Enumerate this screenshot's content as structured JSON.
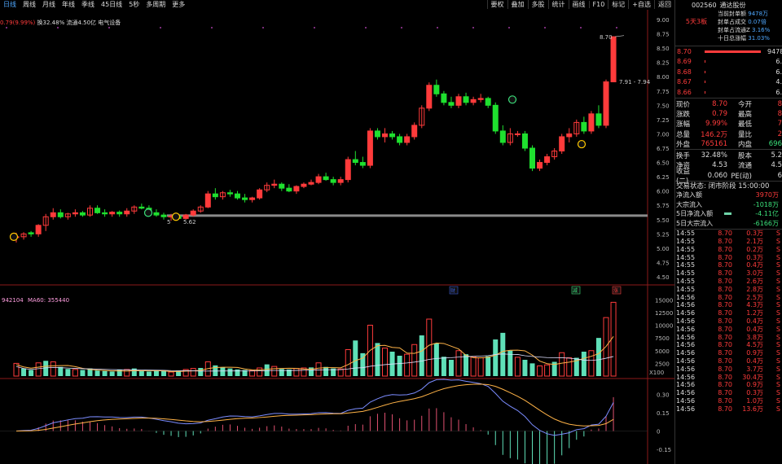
{
  "toolbar": {
    "tabs": [
      "日线",
      "周线",
      "月线",
      "年线",
      "季线",
      "45日线",
      "5秒",
      "多周期",
      "更多"
    ],
    "tools": [
      "要权",
      "叠加",
      "多股",
      "统计",
      "画线",
      "F10",
      "标记",
      "+自选",
      "返回"
    ]
  },
  "info": {
    "price_change": "0.79(9.99%)",
    "turnover": "换32.48%",
    "float": "流通4.50亿",
    "industry": "电气设备"
  },
  "price_axis": [
    "9.00",
    "8.75",
    "8.50",
    "8.25",
    "8.00",
    "7.75",
    "7.50",
    "7.25",
    "7.00",
    "6.75",
    "6.50",
    "6.25",
    "6.00",
    "5.75",
    "5.50",
    "5.25",
    "5.00",
    "4.75",
    "4.50"
  ],
  "chart_annotations": {
    "high_label": "8.70",
    "range_label": "7.91 - 7.94",
    "low_label": "5.62",
    "left_label": "5"
  },
  "badges": {
    "fin": "财",
    "jian": "减",
    "zhang": "涨"
  },
  "volume": {
    "header": "942104",
    "ma60_label": "MA60: 355440",
    "axis": [
      "15000",
      "12500",
      "10000",
      "7500",
      "5000",
      "2500"
    ],
    "unit": "X100"
  },
  "macd_axis": [
    "0.30",
    "0.15",
    "0",
    "-0.15"
  ],
  "stock": {
    "code": "002560",
    "name": "通达股份",
    "tag": "5天3板",
    "limit_info": [
      {
        "label": "当前封单额",
        "value": "9478万"
      },
      {
        "label": "封单占成交",
        "value": "0.07倍"
      },
      {
        "label": "封单占流通Z",
        "value": "3.16%"
      },
      {
        "label": "十日总涨幅",
        "value": "31.03%"
      }
    ]
  },
  "orderbook": [
    {
      "price": "8.70",
      "volume": "9478",
      "bar": 0.9
    },
    {
      "price": "8.69",
      "volume": "6.",
      "bar": 0.01
    },
    {
      "price": "8.68",
      "volume": "6.",
      "bar": 0.01
    },
    {
      "price": "8.67",
      "volume": "4.",
      "bar": 0.01
    },
    {
      "price": "8.66",
      "volume": "6.",
      "bar": 0.01
    }
  ],
  "quote": [
    {
      "l": "现价",
      "v": "8.70",
      "l2": "今开",
      "v2": "8"
    },
    {
      "l": "涨跌",
      "v": "0.79",
      "l2": "最高",
      "v2": "8"
    },
    {
      "l": "涨幅",
      "v": "9.99%",
      "l2": "最低",
      "v2": "7"
    },
    {
      "l": "总量",
      "v": "146.2万",
      "l2": "量比",
      "v2": "2"
    },
    {
      "l": "外盘",
      "v": "765161",
      "l2": "内盘",
      "v2": "696"
    }
  ],
  "quote2": [
    {
      "l": "换手",
      "v": "32.48%",
      "l2": "股本",
      "v2": "5.2"
    },
    {
      "l": "净资",
      "v": "4.53",
      "l2": "流通",
      "v2": "4.5"
    },
    {
      "l": "收益(二)",
      "v": "0.060",
      "l2": "PE(动)",
      "v2": "6"
    }
  ],
  "status": "交易状态: 闭市阶段 15:00:00",
  "money_flow": [
    {
      "l": "净流入额",
      "v": "3970万",
      "bar": 0,
      "g": false
    },
    {
      "l": "大宗流入",
      "v": "-1018万",
      "bar": 0,
      "g": true
    },
    {
      "l": "5日净流入额",
      "v": "-4.11亿",
      "bar": 0.3,
      "g": true
    },
    {
      "l": "5日大宗流入",
      "v": "-6166万",
      "bar": 0,
      "g": true
    }
  ],
  "ticks": [
    {
      "t": "14:55",
      "p": "8.70",
      "v": "0.3万",
      "s": "S"
    },
    {
      "t": "14:55",
      "p": "8.70",
      "v": "2.1万",
      "s": "S"
    },
    {
      "t": "14:55",
      "p": "8.70",
      "v": "0.2万",
      "s": "S"
    },
    {
      "t": "14:55",
      "p": "8.70",
      "v": "0.3万",
      "s": "S"
    },
    {
      "t": "14:55",
      "p": "8.70",
      "v": "0.4万",
      "s": "S"
    },
    {
      "t": "14:55",
      "p": "8.70",
      "v": "3.0万",
      "s": "S"
    },
    {
      "t": "14:55",
      "p": "8.70",
      "v": "2.6万",
      "s": "S"
    },
    {
      "t": "14:55",
      "p": "8.70",
      "v": "2.8万",
      "s": "S"
    },
    {
      "t": "14:56",
      "p": "8.70",
      "v": "2.5万",
      "s": "S"
    },
    {
      "t": "14:56",
      "p": "8.70",
      "v": "4.3万",
      "s": "S"
    },
    {
      "t": "14:56",
      "p": "8.70",
      "v": "1.2万",
      "s": "S"
    },
    {
      "t": "14:56",
      "p": "8.70",
      "v": "0.4万",
      "s": "S"
    },
    {
      "t": "14:56",
      "p": "8.70",
      "v": "0.4万",
      "s": "S"
    },
    {
      "t": "14:56",
      "p": "8.70",
      "v": "3.8万",
      "s": "S"
    },
    {
      "t": "14:56",
      "p": "8.70",
      "v": "4.5万",
      "s": "S"
    },
    {
      "t": "14:56",
      "p": "8.70",
      "v": "0.9万",
      "s": "S"
    },
    {
      "t": "14:56",
      "p": "8.70",
      "v": "0.4万",
      "s": "S"
    },
    {
      "t": "14:56",
      "p": "8.70",
      "v": "3.7万",
      "s": "S"
    },
    {
      "t": "14:56",
      "p": "8.70",
      "v": "30.4万",
      "s": "S"
    },
    {
      "t": "14:56",
      "p": "8.70",
      "v": "0.9万",
      "s": "S"
    },
    {
      "t": "14:56",
      "p": "8.70",
      "v": "0.3万",
      "s": "S"
    },
    {
      "t": "14:56",
      "p": "8.70",
      "v": "1.0万",
      "s": "S"
    },
    {
      "t": "14:56",
      "p": "8.70",
      "v": "13.6万",
      "s": "S"
    }
  ],
  "colors": {
    "up": "#ff3b3b",
    "down": "#1fe02f",
    "ma": "#ffb347",
    "bg": "#000000"
  },
  "chart_data": {
    "type": "candlestick",
    "candles": [
      [
        5.2,
        5.27,
        5.1,
        5.2
      ],
      [
        5.2,
        5.28,
        5.15,
        5.25
      ],
      [
        5.27,
        5.3,
        5.2,
        5.25
      ],
      [
        5.25,
        5.42,
        5.2,
        5.4
      ],
      [
        5.4,
        5.6,
        5.3,
        5.55
      ],
      [
        5.55,
        5.7,
        5.5,
        5.62
      ],
      [
        5.62,
        5.68,
        5.52,
        5.55
      ],
      [
        5.55,
        5.62,
        5.5,
        5.6
      ],
      [
        5.6,
        5.68,
        5.55,
        5.62
      ],
      [
        5.62,
        5.65,
        5.55,
        5.58
      ],
      [
        5.58,
        5.75,
        5.55,
        5.7
      ],
      [
        5.7,
        5.75,
        5.6,
        5.62
      ],
      [
        5.62,
        5.68,
        5.55,
        5.6
      ],
      [
        5.6,
        5.65,
        5.55,
        5.63
      ],
      [
        5.63,
        5.66,
        5.55,
        5.6
      ],
      [
        5.6,
        5.7,
        5.55,
        5.65
      ],
      [
        5.65,
        5.75,
        5.6,
        5.72
      ],
      [
        5.72,
        5.78,
        5.68,
        5.7
      ],
      [
        5.7,
        5.75,
        5.6,
        5.62
      ],
      [
        5.62,
        5.68,
        5.55,
        5.58
      ],
      [
        5.58,
        5.62,
        5.5,
        5.55
      ],
      [
        5.55,
        5.6,
        5.48,
        5.56
      ],
      [
        5.56,
        5.6,
        5.5,
        5.52
      ],
      [
        5.52,
        5.6,
        5.5,
        5.58
      ],
      [
        5.58,
        5.68,
        5.55,
        5.65
      ],
      [
        5.65,
        5.75,
        5.62,
        5.72
      ],
      [
        5.72,
        6.0,
        5.7,
        5.95
      ],
      [
        5.95,
        6.05,
        5.85,
        5.9
      ],
      [
        5.9,
        6.0,
        5.85,
        5.97
      ],
      [
        5.97,
        6.02,
        5.9,
        5.95
      ],
      [
        5.95,
        6.0,
        5.85,
        5.88
      ],
      [
        5.88,
        5.95,
        5.8,
        5.85
      ],
      [
        5.85,
        5.9,
        5.8,
        5.88
      ],
      [
        5.88,
        6.05,
        5.85,
        6.02
      ],
      [
        6.02,
        6.15,
        5.98,
        6.1
      ],
      [
        6.1,
        6.2,
        6.05,
        6.12
      ],
      [
        6.12,
        6.15,
        6.0,
        6.05
      ],
      [
        6.05,
        6.12,
        5.98,
        6.0
      ],
      [
        6.0,
        6.1,
        5.95,
        6.08
      ],
      [
        6.08,
        6.15,
        6.05,
        6.12
      ],
      [
        6.12,
        6.2,
        6.1,
        6.15
      ],
      [
        6.15,
        6.3,
        6.12,
        6.25
      ],
      [
        6.25,
        6.32,
        6.18,
        6.2
      ],
      [
        6.2,
        6.25,
        6.1,
        6.15
      ],
      [
        6.15,
        6.25,
        6.1,
        6.2
      ],
      [
        6.2,
        6.6,
        6.15,
        6.55
      ],
      [
        6.55,
        6.7,
        6.45,
        6.5
      ],
      [
        6.5,
        6.6,
        6.4,
        6.45
      ],
      [
        6.45,
        7.1,
        6.4,
        7.05
      ],
      [
        7.05,
        7.1,
        6.9,
        6.95
      ],
      [
        6.95,
        7.1,
        6.85,
        7.0
      ],
      [
        7.0,
        7.05,
        6.9,
        6.95
      ],
      [
        6.95,
        7.0,
        6.8,
        6.85
      ],
      [
        6.85,
        7.0,
        6.8,
        6.95
      ],
      [
        6.95,
        7.2,
        6.9,
        7.15
      ],
      [
        7.15,
        7.5,
        7.1,
        7.45
      ],
      [
        7.45,
        7.9,
        7.4,
        7.85
      ],
      [
        7.85,
        7.95,
        7.65,
        7.7
      ],
      [
        7.7,
        7.75,
        7.5,
        7.55
      ],
      [
        7.55,
        7.65,
        7.45,
        7.5
      ],
      [
        7.5,
        7.7,
        7.45,
        7.65
      ],
      [
        7.65,
        7.72,
        7.5,
        7.55
      ],
      [
        7.55,
        7.65,
        7.5,
        7.6
      ],
      [
        7.6,
        7.7,
        7.55,
        7.62
      ],
      [
        7.62,
        7.65,
        7.45,
        7.5
      ],
      [
        7.5,
        7.55,
        7.0,
        7.05
      ],
      [
        7.05,
        7.15,
        6.8,
        6.85
      ],
      [
        6.85,
        7.1,
        6.8,
        7.0
      ],
      [
        7.0,
        7.05,
        6.95,
        7.0
      ],
      [
        7.0,
        7.05,
        6.7,
        6.75
      ],
      [
        6.75,
        6.8,
        6.35,
        6.4
      ],
      [
        6.4,
        6.55,
        6.35,
        6.5
      ],
      [
        6.5,
        6.65,
        6.45,
        6.6
      ],
      [
        6.6,
        6.75,
        6.55,
        6.7
      ],
      [
        6.7,
        7.0,
        6.65,
        6.95
      ],
      [
        6.95,
        7.1,
        6.85,
        7.0
      ],
      [
        7.0,
        7.25,
        6.95,
        7.2
      ],
      [
        7.2,
        7.3,
        7.0,
        7.05
      ],
      [
        7.05,
        7.4,
        7.0,
        7.35
      ],
      [
        7.35,
        7.5,
        7.1,
        7.15
      ],
      [
        7.15,
        7.95,
        7.1,
        7.91
      ],
      [
        7.91,
        8.7,
        7.91,
        8.7
      ]
    ],
    "volume": [
      2500,
      1500,
      1200,
      2600,
      3000,
      2800,
      1800,
      1400,
      1300,
      1200,
      1500,
      1100,
      1000,
      900,
      1200,
      1300,
      1500,
      1000,
      900,
      1200,
      1100,
      800,
      1000,
      1300,
      1500,
      1600,
      2800,
      2100,
      1700,
      1500,
      1300,
      1200,
      1100,
      1600,
      2300,
      1900,
      1400,
      1300,
      1500,
      1600,
      1700,
      2600,
      1800,
      1500,
      1400,
      5200,
      7000,
      4500,
      10000,
      6500,
      5500,
      4800,
      4000,
      4300,
      6200,
      8000,
      11200,
      6400,
      3800,
      3200,
      5000,
      4300,
      3800,
      3600,
      3900,
      7200,
      8500,
      5000,
      3700,
      3200,
      2500,
      2000,
      2200,
      2800,
      4600,
      3600,
      3600,
      4800,
      5000,
      7500,
      11500,
      14500
    ],
    "volume_ma_pct": 0.6,
    "ylim": [
      4.5,
      9.0
    ],
    "volume_ylim": [
      0,
      16000
    ],
    "macd_ylim": [
      -0.25,
      0.35
    ]
  }
}
